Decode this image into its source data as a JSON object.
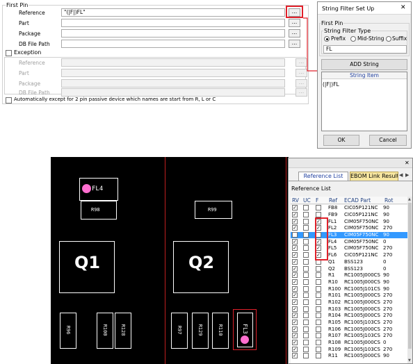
{
  "first_pin_panel": {
    "group_title": "First Pin",
    "fields": [
      {
        "label": "Reference",
        "value": "\"(|F|)FL\""
      },
      {
        "label": "Part",
        "value": ""
      },
      {
        "label": "Package",
        "value": ""
      },
      {
        "label": "DB File Path",
        "value": ""
      }
    ],
    "browse_label": "...",
    "exception_label": "Exception",
    "exception_fields": [
      {
        "label": "Reference"
      },
      {
        "label": "Part"
      },
      {
        "label": "Package"
      },
      {
        "label": "DB File Path"
      }
    ],
    "auto_except_label": "Automatically except for 2 pin passive device which names are start from R, L or C"
  },
  "dialog": {
    "title": "String Filter Set Up",
    "close_label": "✕",
    "group_title": "First Pin",
    "filter_type_title": "String Filter Type",
    "options": [
      "Prefix",
      "Mid-String",
      "Suffix"
    ],
    "selected_option": "Prefix",
    "input_value": "FL",
    "add_button": "ADD String",
    "list_header": "String Item",
    "list_items": [
      "(|F|)FL"
    ],
    "ok_button": "OK",
    "cancel_button": "Cancel"
  },
  "pcb": {
    "components": [
      {
        "ref": "FL4"
      },
      {
        "ref": "R98"
      },
      {
        "ref": "R99"
      },
      {
        "ref": "Q1"
      },
      {
        "ref": "Q2"
      },
      {
        "ref": "R96"
      },
      {
        "ref": "R100"
      },
      {
        "ref": "R128"
      },
      {
        "ref": "R97"
      },
      {
        "ref": "R129"
      },
      {
        "ref": "R110"
      },
      {
        "ref": "FL3"
      }
    ],
    "highlight_color": "#e0202a",
    "marker_color": "#ff6fd0"
  },
  "ref_list": {
    "tabs": [
      "Reference List",
      "EBOM Link Result"
    ],
    "active_tab": "Reference List",
    "section_label": "Reference List",
    "columns": [
      "RV",
      "UC",
      "F",
      "Ref",
      "ECAD Part",
      "Rot"
    ],
    "rows": [
      {
        "rv": true,
        "uc": false,
        "f": false,
        "ref": "FB8",
        "part": "CIC05P121NC",
        "rot": "90"
      },
      {
        "rv": true,
        "uc": false,
        "f": false,
        "ref": "FB9",
        "part": "CIC05P121NC",
        "rot": "90"
      },
      {
        "rv": true,
        "uc": false,
        "f": true,
        "ref": "FL1",
        "part": "CIM05F750NC",
        "rot": "90"
      },
      {
        "rv": true,
        "uc": false,
        "f": true,
        "ref": "FL2",
        "part": "CIM05F750NC",
        "rot": "270"
      },
      {
        "rv": true,
        "uc": false,
        "f": true,
        "ref": "FL3",
        "part": "CIM05F750NC",
        "rot": "90",
        "selected": true
      },
      {
        "rv": true,
        "uc": false,
        "f": true,
        "ref": "FL4",
        "part": "CIM05F750NC",
        "rot": "0"
      },
      {
        "rv": true,
        "uc": false,
        "f": true,
        "ref": "FL5",
        "part": "CIM05F750NC",
        "rot": "270"
      },
      {
        "rv": true,
        "uc": false,
        "f": true,
        "ref": "FL6",
        "part": "CIC05P121NC",
        "rot": "270"
      },
      {
        "rv": true,
        "uc": false,
        "f": false,
        "ref": "Q1",
        "part": "BSS123",
        "rot": "0"
      },
      {
        "rv": true,
        "uc": false,
        "f": false,
        "ref": "Q2",
        "part": "BSS123",
        "rot": "0"
      },
      {
        "rv": true,
        "uc": false,
        "f": false,
        "ref": "R1",
        "part": "RC1005J000CS",
        "rot": "90"
      },
      {
        "rv": true,
        "uc": false,
        "f": false,
        "ref": "R10",
        "part": "RC1005J000CS",
        "rot": "90"
      },
      {
        "rv": true,
        "uc": false,
        "f": false,
        "ref": "R100",
        "part": "RC1005J101CS",
        "rot": "90"
      },
      {
        "rv": true,
        "uc": false,
        "f": false,
        "ref": "R101",
        "part": "RC1005J000CS",
        "rot": "270"
      },
      {
        "rv": true,
        "uc": false,
        "f": false,
        "ref": "R102",
        "part": "RC1005J000CS",
        "rot": "270"
      },
      {
        "rv": true,
        "uc": false,
        "f": false,
        "ref": "R103",
        "part": "RC1005J000CS",
        "rot": "270"
      },
      {
        "rv": true,
        "uc": false,
        "f": false,
        "ref": "R104",
        "part": "RC1005J000CS",
        "rot": "270"
      },
      {
        "rv": true,
        "uc": false,
        "f": false,
        "ref": "R105",
        "part": "RC1005J103CS",
        "rot": "270"
      },
      {
        "rv": true,
        "uc": false,
        "f": false,
        "ref": "R106",
        "part": "RC1005J000CS",
        "rot": "270"
      },
      {
        "rv": true,
        "uc": false,
        "f": false,
        "ref": "R107",
        "part": "RC1005J103CS",
        "rot": "270"
      },
      {
        "rv": true,
        "uc": false,
        "f": false,
        "ref": "R108",
        "part": "RC1005J000CS",
        "rot": "0"
      },
      {
        "rv": true,
        "uc": false,
        "f": false,
        "ref": "R109",
        "part": "RC1005J103CS",
        "rot": "270"
      },
      {
        "rv": true,
        "uc": false,
        "f": false,
        "ref": "R11",
        "part": "RC1005J000CS",
        "rot": "90"
      }
    ]
  }
}
